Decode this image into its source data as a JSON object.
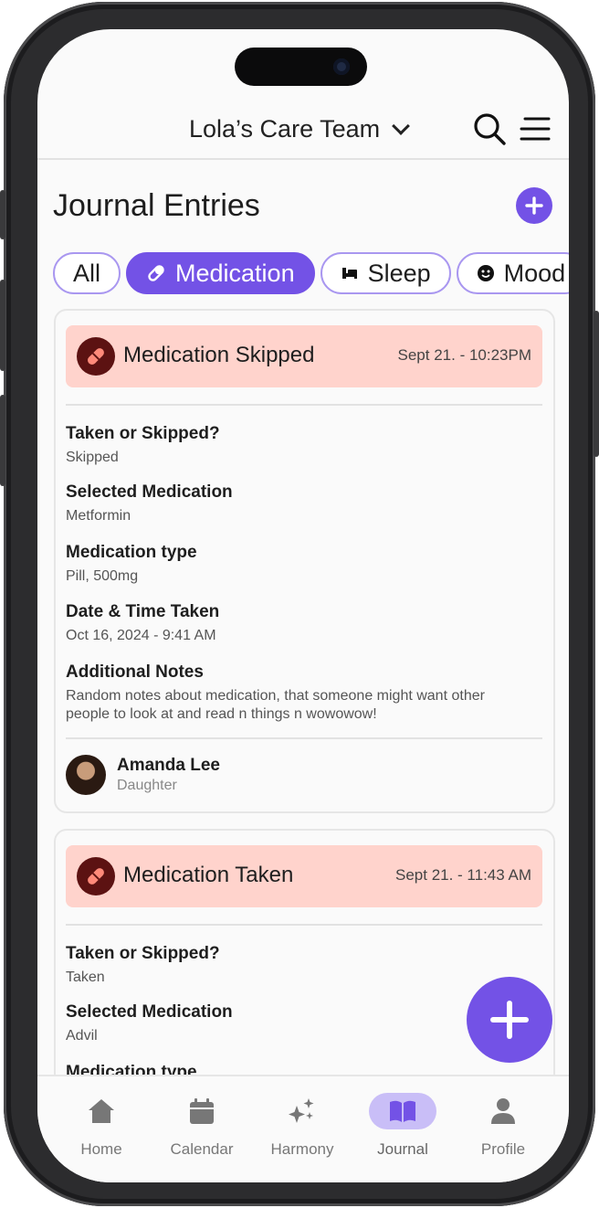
{
  "header": {
    "team_name": "Lola’s Care Team"
  },
  "page": {
    "title": "Journal Entries"
  },
  "filters": [
    {
      "label": "All",
      "active": false,
      "icon": ""
    },
    {
      "label": "Medication",
      "active": true,
      "icon": "pill-icon"
    },
    {
      "label": "Sleep",
      "active": false,
      "icon": "bed-icon"
    },
    {
      "label": "Mood",
      "active": false,
      "icon": "smiley-icon"
    }
  ],
  "entries": [
    {
      "title": "Medication Skipped",
      "time": "Sept 21. - 10:23PM",
      "fields": [
        {
          "label": "Taken or Skipped?",
          "value": "Skipped"
        },
        {
          "label": "Selected Medication",
          "value": "Metformin"
        },
        {
          "label": "Medication type",
          "value": "Pill, 500mg"
        },
        {
          "label": "Date & Time Taken",
          "value": "Oct 16, 2024 - 9:41 AM"
        },
        {
          "label": "Additional Notes",
          "value": "Random notes about medication, that someone might want other people to look at and read n things n wowowow!"
        }
      ],
      "author": {
        "name": "Amanda Lee",
        "role": "Daughter"
      }
    },
    {
      "title": "Medication Taken",
      "time": "Sept 21. - 11:43 AM",
      "fields": [
        {
          "label": "Taken or Skipped?",
          "value": "Taken"
        },
        {
          "label": "Selected Medication",
          "value": "Advil"
        },
        {
          "label": "Medication type",
          "value": ""
        }
      ]
    }
  ],
  "tabs": [
    {
      "label": "Home",
      "icon": "home-icon"
    },
    {
      "label": "Calendar",
      "icon": "calendar-icon"
    },
    {
      "label": "Harmony",
      "icon": "sparkles-icon"
    },
    {
      "label": "Journal",
      "icon": "book-icon",
      "active": true
    },
    {
      "label": "Profile",
      "icon": "person-icon"
    }
  ],
  "colors": {
    "accent": "#7352e6",
    "banner": "#ffd3cc",
    "badge": "#5c1212",
    "active_tab": "#c9bef7"
  }
}
